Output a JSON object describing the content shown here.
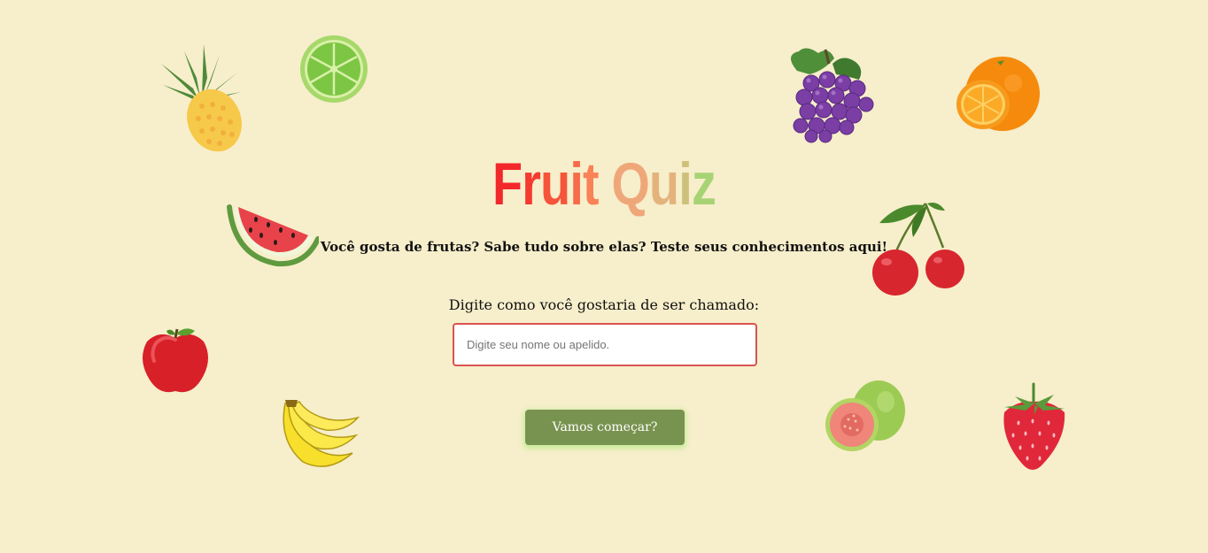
{
  "title": {
    "letters": [
      {
        "char": "F",
        "color": "#f2282b"
      },
      {
        "char": "r",
        "color": "#f53a2f"
      },
      {
        "char": "u",
        "color": "#f6553b"
      },
      {
        "char": "i",
        "color": "#f76b49"
      },
      {
        "char": "t",
        "color": "#f98257"
      },
      {
        "char": " ",
        "color": "#ffffff"
      },
      {
        "char": "Q",
        "color": "#efa779"
      },
      {
        "char": "u",
        "color": "#e4b37c"
      },
      {
        "char": "i",
        "color": "#cdc07a"
      },
      {
        "char": "z",
        "color": "#a7d375"
      }
    ]
  },
  "subtitle": "Você gosta de frutas? Sabe tudo sobre elas? Teste seus conhecimentos aqui!",
  "form": {
    "prompt": "Digite como você gostaria de ser chamado:",
    "name_placeholder": "Digite seu nome ou apelido.",
    "name_value": "",
    "start_label": "Vamos começar?"
  },
  "decorations": [
    {
      "name": "pineapple-icon"
    },
    {
      "name": "lime-icon"
    },
    {
      "name": "grapes-icon"
    },
    {
      "name": "orange-icon"
    },
    {
      "name": "watermelon-icon"
    },
    {
      "name": "cherries-icon"
    },
    {
      "name": "apple-icon"
    },
    {
      "name": "banana-icon"
    },
    {
      "name": "guava-icon"
    },
    {
      "name": "strawberry-icon"
    }
  ],
  "colors": {
    "background": "#f7eecb",
    "button": "#78934f",
    "input_border": "#d9534f"
  }
}
